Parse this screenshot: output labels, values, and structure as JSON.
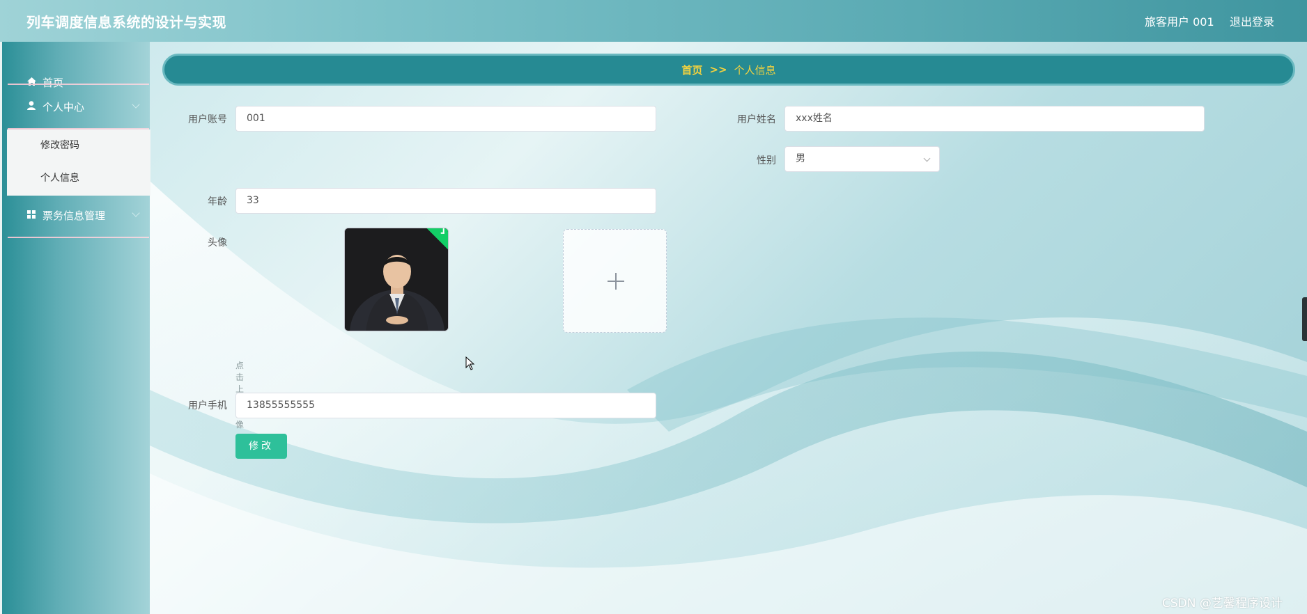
{
  "header": {
    "app_title": "列车调度信息系统的设计与实现",
    "user_name": "旅客用户 001",
    "logout_label": "退出登录"
  },
  "sidebar": {
    "items": [
      {
        "label": "首页",
        "icon": "home-icon"
      },
      {
        "label": "个人中心",
        "icon": "user-icon",
        "expanded": true,
        "children": [
          {
            "label": "修改密码"
          },
          {
            "label": "个人信息"
          }
        ]
      },
      {
        "label": "票务信息管理",
        "icon": "grid-icon",
        "expanded": false
      }
    ]
  },
  "breadcrumb": {
    "home": "首页",
    "separator": ">>",
    "current": "个人信息"
  },
  "form": {
    "account": {
      "label": "用户账号",
      "value": "001"
    },
    "name": {
      "label": "用户姓名",
      "value": "xxx姓名"
    },
    "gender": {
      "label": "性别",
      "value": "男"
    },
    "age": {
      "label": "年龄",
      "value": "33"
    },
    "avatar": {
      "label": "头像",
      "upload_tip": "点击上传头像"
    },
    "phone": {
      "label": "用户手机",
      "value": "13855555555"
    },
    "submit_label": "修改"
  },
  "watermark": "CSDN @艺馨程序设计",
  "colors": {
    "header_gradient_start": "#9fd3d7",
    "header_gradient_end": "#3f959f",
    "breadcrumb_bg": "#268a93",
    "breadcrumb_text": "#f5d33e",
    "submit_button": "#2ec09a",
    "upload_success": "#13ce66"
  }
}
